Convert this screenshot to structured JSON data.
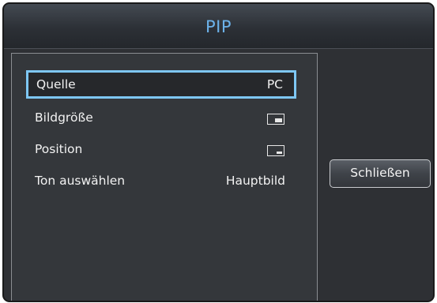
{
  "dialog": {
    "title": "PIP",
    "menu": {
      "items": [
        {
          "label": "Quelle",
          "value": "PC",
          "selected": true
        },
        {
          "label": "Bildgröße",
          "icon": "pip-size-icon"
        },
        {
          "label": "Position",
          "icon": "pip-position-icon"
        },
        {
          "label": "Ton auswählen",
          "value": "Hauptbild"
        }
      ]
    },
    "close_label": "Schließen"
  },
  "colors": {
    "title": "#6cb2ea",
    "selection_border": "#7ec7f4",
    "background": "#2e3034"
  }
}
